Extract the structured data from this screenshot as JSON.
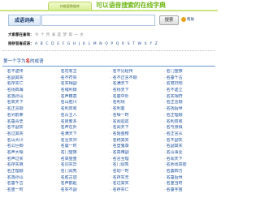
{
  "header": {
    "top_tab": "持能复数据库",
    "banner": "可以语音搜索的在线字典"
  },
  "search": {
    "title": "成语词典",
    "input_value": "",
    "placeholder": "",
    "button_label": "搜索",
    "help_label": "帮助"
  },
  "first_char_row": {
    "label": "大家都在查询：",
    "items": "今 个 月 表 是 梦 雨 一 水"
  },
  "pinyin_row": {
    "label": "按拼音查成语：",
    "letters": "A B C D E F G H J K L M N O P Q R S T W X Y Z"
  },
  "section": {
    "prefix": "第一个字为",
    "char": "名",
    "suffix": "的成语"
  },
  "idioms": {
    "col1": [
      "名不虚传",
      "名副其实",
      "名存实亡",
      "名扬四海",
      "名落孙山",
      "名高天下",
      "名正言顺",
      "名列前茅",
      "名垂青史",
      "名不副实",
      "名过其实",
      "名山大川",
      "名公巨卿",
      "名声大噪",
      "名声过实",
      "名存实爽",
      "名正理顺",
      "名落孙山",
      "名垂千古",
      "名重一时"
    ],
    "col2": [
      "名花有主",
      "名不符实",
      "名实相副",
      "名缰利锁",
      "名声籍甚",
      "名山胜川",
      "名利双收",
      "名从主人",
      "名目繁多",
      "名声在外",
      "名满天下",
      "名至实归",
      "名震一时",
      "名门望族",
      "名高望重",
      "名同实异",
      "名门闺秀",
      "名胜古迹",
      "名声鹊起",
      "名实不副"
    ],
    "col3": [
      "名不见经传",
      "名不正言不顺",
      "名满天下",
      "名扬天下",
      "名震中外",
      "名利场",
      "名利客",
      "名噪一时",
      "名闻遐迩",
      "名闻天下",
      "名题金榜",
      "名称其实",
      "名登鬼箓",
      "名高难副",
      "名言至理",
      "名门闺秀",
      "名动一时",
      "名存实无",
      "名过其实",
      "名存实亡"
    ],
    "col4": [
      "名门望族",
      "名垂千古",
      "名誉扫地",
      "名不虚立",
      "名实相符",
      "名正言顺",
      "名扬后世",
      "名正理顺",
      "名利双收",
      "名与身俱",
      "名正言从",
      "名不副实",
      "名副其实",
      "名山事业",
      "名闻天下",
      "名师出高徒",
      "名震四方",
      "名垂后世",
      "名重当时",
      "名垂宇宙"
    ]
  }
}
